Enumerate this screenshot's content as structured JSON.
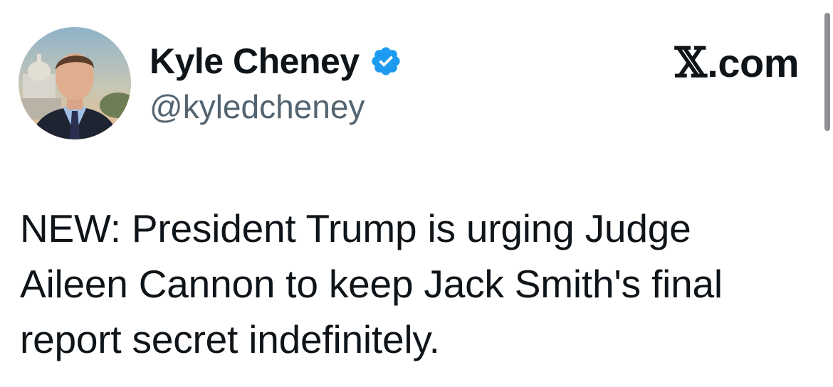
{
  "author": {
    "display_name": "Kyle Cheney",
    "handle": "@kyledcheney",
    "verified": true,
    "verified_color": "#1d9bf0",
    "avatar": "profile-photo"
  },
  "brand": {
    "x_glyph": "𝕏",
    "domain": ".com"
  },
  "tweet": {
    "lines": [
      "NEW: President Trump is urging Judge",
      "Aileen Cannon to keep Jack Smith's final",
      "report secret indefinitely."
    ]
  },
  "colors": {
    "text": "#0f1419",
    "secondary": "#536471",
    "background": "#ffffff"
  }
}
